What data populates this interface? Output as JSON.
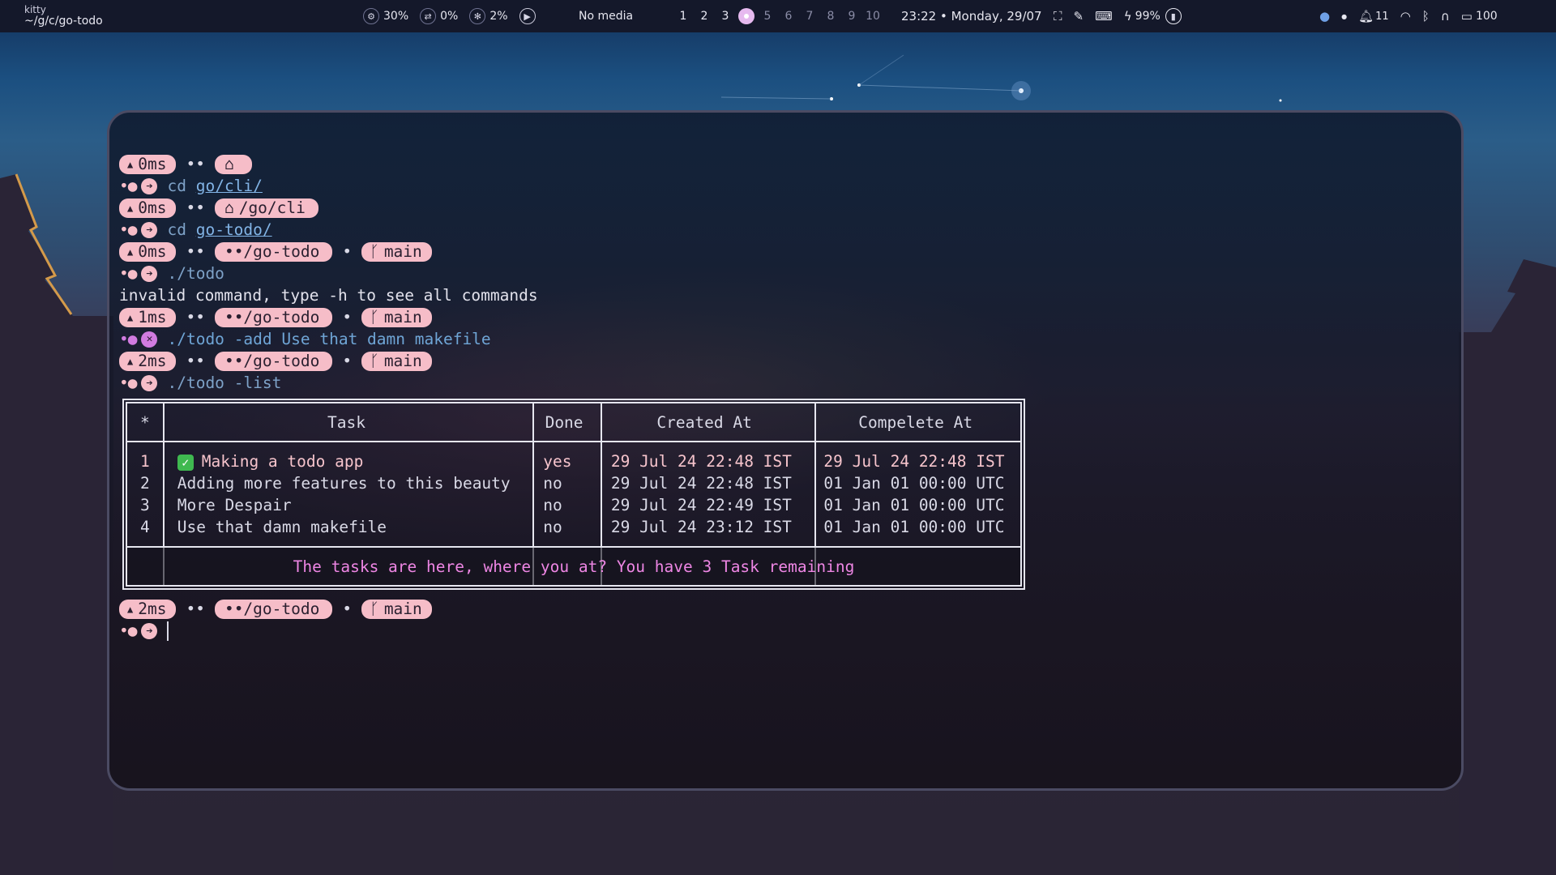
{
  "topbar": {
    "window_class": "kitty",
    "window_path": "~/g/c/go-todo",
    "cpu": "30%",
    "swap": "0%",
    "memory": "2%",
    "media": "No media",
    "workspaces": [
      "1",
      "2",
      "3",
      "4",
      "5",
      "6",
      "7",
      "8",
      "9",
      "10"
    ],
    "active_workspace": "4",
    "clock": "23:22 • Monday, 29/07",
    "battery": "99%",
    "notifications": "11",
    "keyboard_value": "100"
  },
  "terminal": {
    "prompts": [
      {
        "time": "0ms",
        "path": "",
        "branch": ""
      },
      {
        "time": "0ms",
        "path": "/go/cli",
        "branch": ""
      },
      {
        "time": "0ms",
        "path": "••/go-todo",
        "branch": "main"
      },
      {
        "time": "1ms",
        "path": "••/go-todo",
        "branch": "main"
      },
      {
        "time": "2ms",
        "path": "••/go-todo",
        "branch": "main"
      },
      {
        "time": "2ms",
        "path": "••/go-todo",
        "branch": "main"
      }
    ],
    "commands": [
      {
        "cmd": "cd",
        "arg": "go/cli/"
      },
      {
        "cmd": "cd",
        "arg": "go-todo/"
      },
      {
        "cmd": "./todo",
        "arg": ""
      },
      {
        "cmd": "./todo",
        "arg": "-add Use that damn makefile"
      },
      {
        "cmd": "./todo",
        "arg": "-list"
      }
    ],
    "error_output": "invalid command, type -h to see all commands",
    "table": {
      "headers": [
        "*",
        "Task",
        "Done",
        "Created At",
        "Compelete At"
      ],
      "rows": [
        {
          "n": "1",
          "task": "Making a todo app",
          "done": "yes",
          "created": "29 Jul 24 22:48 IST",
          "completed": "29 Jul 24 22:48 IST"
        },
        {
          "n": "2",
          "task": "Adding more features to this beauty",
          "done": "no",
          "created": "29 Jul 24 22:48 IST",
          "completed": "01 Jan 01 00:00 UTC"
        },
        {
          "n": "3",
          "task": "More Despair",
          "done": "no",
          "created": "29 Jul 24 22:49 IST",
          "completed": "01 Jan 01 00:00 UTC"
        },
        {
          "n": "4",
          "task": "Use that damn makefile",
          "done": "no",
          "created": "29 Jul 24 23:12 IST",
          "completed": "01 Jan 01 00:00 UTC"
        }
      ],
      "footer": "The tasks are here, where you at? You have 3 Task remaining"
    }
  },
  "colors": {
    "pill": "#f6bdc8",
    "error_pill": "#d17be0",
    "footer_text": "#ee86e4",
    "command": "#7ea2c8"
  }
}
